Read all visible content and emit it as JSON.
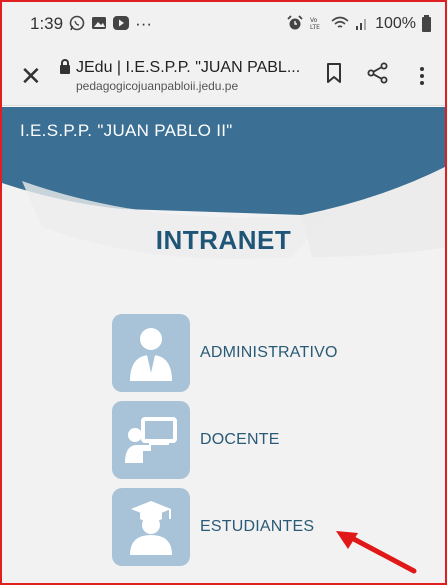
{
  "status_bar": {
    "time": "1:39",
    "left_icons": [
      "whatsapp-icon",
      "image-icon",
      "play-icon",
      "more-icon"
    ],
    "more": "···",
    "right_icons": [
      "alarm-icon",
      "volte-icon",
      "wifi-icon",
      "signal-icon"
    ],
    "battery": "100%"
  },
  "browser": {
    "tab_title": "JEdu | I.E.S.P.P. \"JUAN PABL...",
    "domain": "pedagogicojuanpabloii.jedu.pe"
  },
  "site": {
    "name": "I.E.S.P.P. \"JUAN PABLO II\"",
    "heading": "INTRANET"
  },
  "menu": [
    {
      "label": "ADMINISTRATIVO",
      "icon": "administrator-icon"
    },
    {
      "label": "DOCENTE",
      "icon": "teacher-icon"
    },
    {
      "label": "ESTUDIANTES",
      "icon": "student-icon"
    }
  ],
  "colors": {
    "banner": "#3b6f93",
    "heading": "#1f5577",
    "icon_bg": "#a8c3d7",
    "annotation_arrow": "#e01818",
    "frame_border": "#e02020"
  }
}
